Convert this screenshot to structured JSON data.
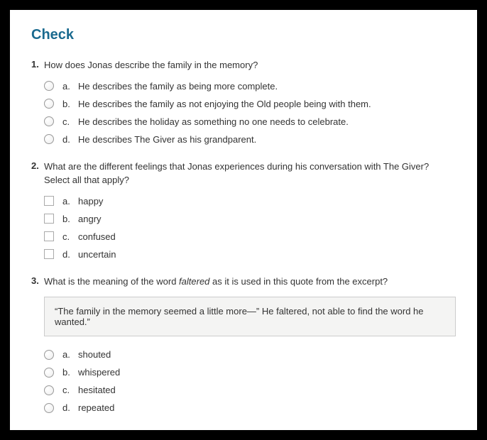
{
  "title": "Check",
  "questions": [
    {
      "number": "1.",
      "text": "How does Jonas describe the family in the memory?",
      "type": "radio",
      "options": [
        {
          "letter": "a.",
          "text": "He describes the family as being more complete."
        },
        {
          "letter": "b.",
          "text": "He describes the family as not enjoying the Old people being with them."
        },
        {
          "letter": "c.",
          "text": "He describes the holiday as something no one needs to celebrate."
        },
        {
          "letter": "d.",
          "text": "He describes The Giver as his grandparent."
        }
      ]
    },
    {
      "number": "2.",
      "text": "What are the different feelings that Jonas experiences during his conversation with The Giver? Select all that apply?",
      "type": "checkbox",
      "options": [
        {
          "letter": "a.",
          "text": "happy"
        },
        {
          "letter": "b.",
          "text": "angry"
        },
        {
          "letter": "c.",
          "text": "confused"
        },
        {
          "letter": "d.",
          "text": "uncertain"
        }
      ]
    },
    {
      "number": "3.",
      "text_pre": "What is the meaning of the word ",
      "text_italic": "faltered",
      "text_post": " as it is used in this quote from the excerpt?",
      "type": "radio",
      "quote": "“The family in the memory seemed a little more—” He faltered, not able to find the word he wanted.”",
      "options": [
        {
          "letter": "a.",
          "text": "shouted"
        },
        {
          "letter": "b.",
          "text": "whispered"
        },
        {
          "letter": "c.",
          "text": "hesitated"
        },
        {
          "letter": "d.",
          "text": "repeated"
        }
      ]
    }
  ]
}
